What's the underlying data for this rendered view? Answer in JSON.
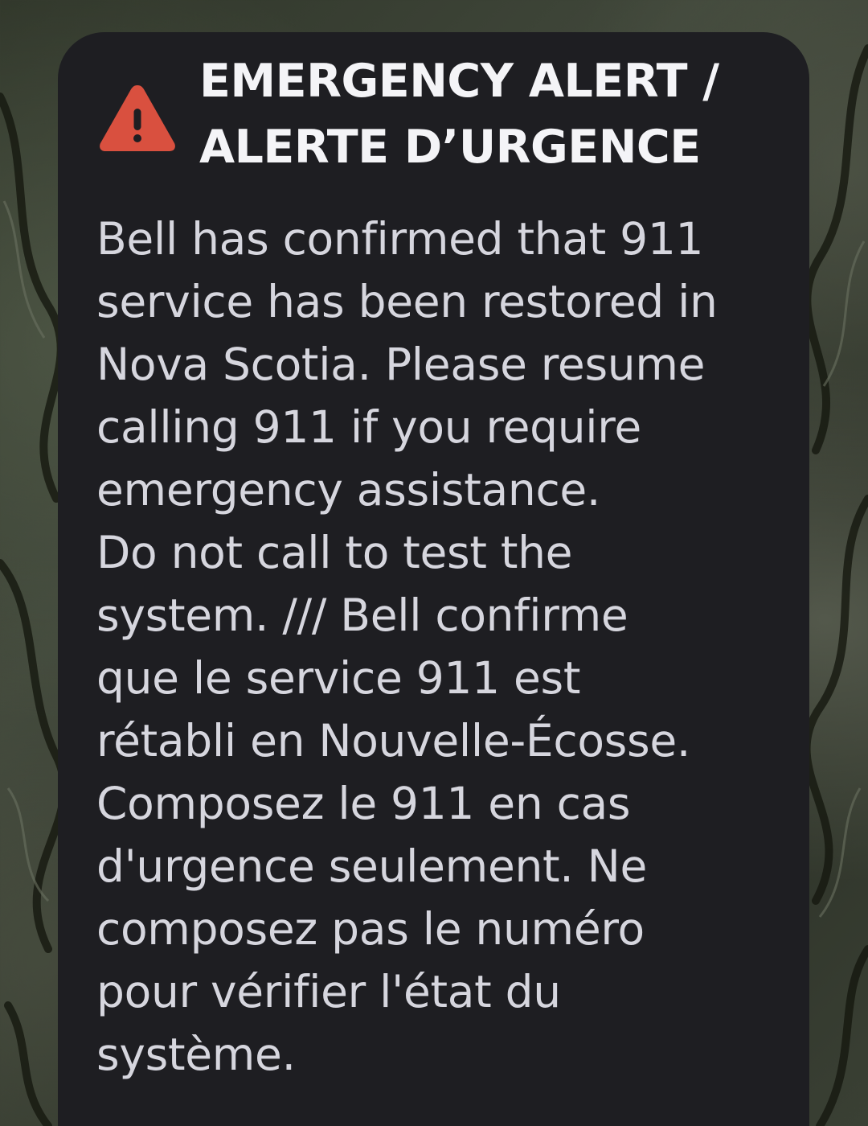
{
  "alert": {
    "icon": "warning-triangle-icon",
    "icon_color": "#d9503f",
    "card_background": "#1e1e22",
    "title_line_1": "EMERGENCY ALERT /",
    "title_line_2": "ALERTE D’URGENCE",
    "message": "Bell has confirmed that 911\nservice has been restored in\nNova Scotia. Please resume\ncalling 911 if you require\nemergency assistance.\nDo not call to test the\nsystem. /// Bell confirme\nque le service 911 est\nrétabli en Nouvelle-Écosse.\nComposez le 911 en cas\nd'urgence seulement. Ne\ncomposez pas le numéro\npour vérifier l'état du\nsystème."
  }
}
